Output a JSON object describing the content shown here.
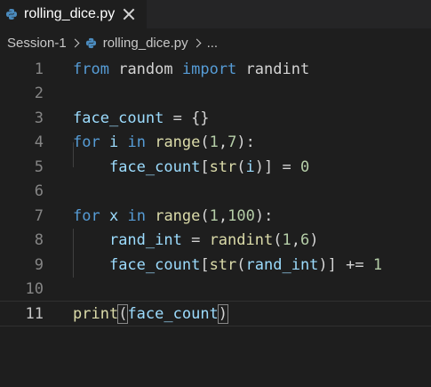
{
  "tab": {
    "label": "rolling_dice.py",
    "icon": "python-icon"
  },
  "breadcrumb": {
    "session": "Session-1",
    "file": "rolling_dice.py",
    "more": "..."
  },
  "colors": {
    "background": "#1e1e1e",
    "keyword": "#569cd6",
    "function": "#dcdcaa",
    "variable": "#9cdcfe",
    "number": "#b5cea8",
    "line_number": "#858585"
  },
  "code": {
    "line_numbers": [
      "1",
      "2",
      "3",
      "4",
      "5",
      "6",
      "7",
      "8",
      "9",
      "10",
      "11"
    ],
    "l1": {
      "t1": "from",
      "t2": " ",
      "t3": "random",
      "t4": " ",
      "t5": "import",
      "t6": " ",
      "t7": "randint"
    },
    "l3": {
      "t1": "face_count",
      "t2": " = {}"
    },
    "l4": {
      "t1": "for",
      "t2": " ",
      "t3": "i",
      "t4": " ",
      "t5": "in",
      "t6": " ",
      "t7": "range",
      "t8": "(",
      "t9": "1",
      "t10": ",",
      "t11": "7",
      "t12": "):"
    },
    "l5": {
      "t0": "    ",
      "t1": "face_count",
      "t2": "[",
      "t3": "str",
      "t4": "(",
      "t5": "i",
      "t6": ")] = ",
      "t7": "0"
    },
    "l7": {
      "t1": "for",
      "t2": " ",
      "t3": "x",
      "t4": " ",
      "t5": "in",
      "t6": " ",
      "t7": "range",
      "t8": "(",
      "t9": "1",
      "t10": ",",
      "t11": "100",
      "t12": "):"
    },
    "l8": {
      "t0": "    ",
      "t1": "rand_int",
      "t2": " = ",
      "t3": "randint",
      "t4": "(",
      "t5": "1",
      "t6": ",",
      "t7": "6",
      "t8": ")"
    },
    "l9": {
      "t0": "    ",
      "t1": "face_count",
      "t2": "[",
      "t3": "str",
      "t4": "(",
      "t5": "rand_int",
      "t6": ")] += ",
      "t7": "1"
    },
    "l11": {
      "t1": "print",
      "t2": "(",
      "t3": "face_count",
      "t4": ")"
    }
  }
}
